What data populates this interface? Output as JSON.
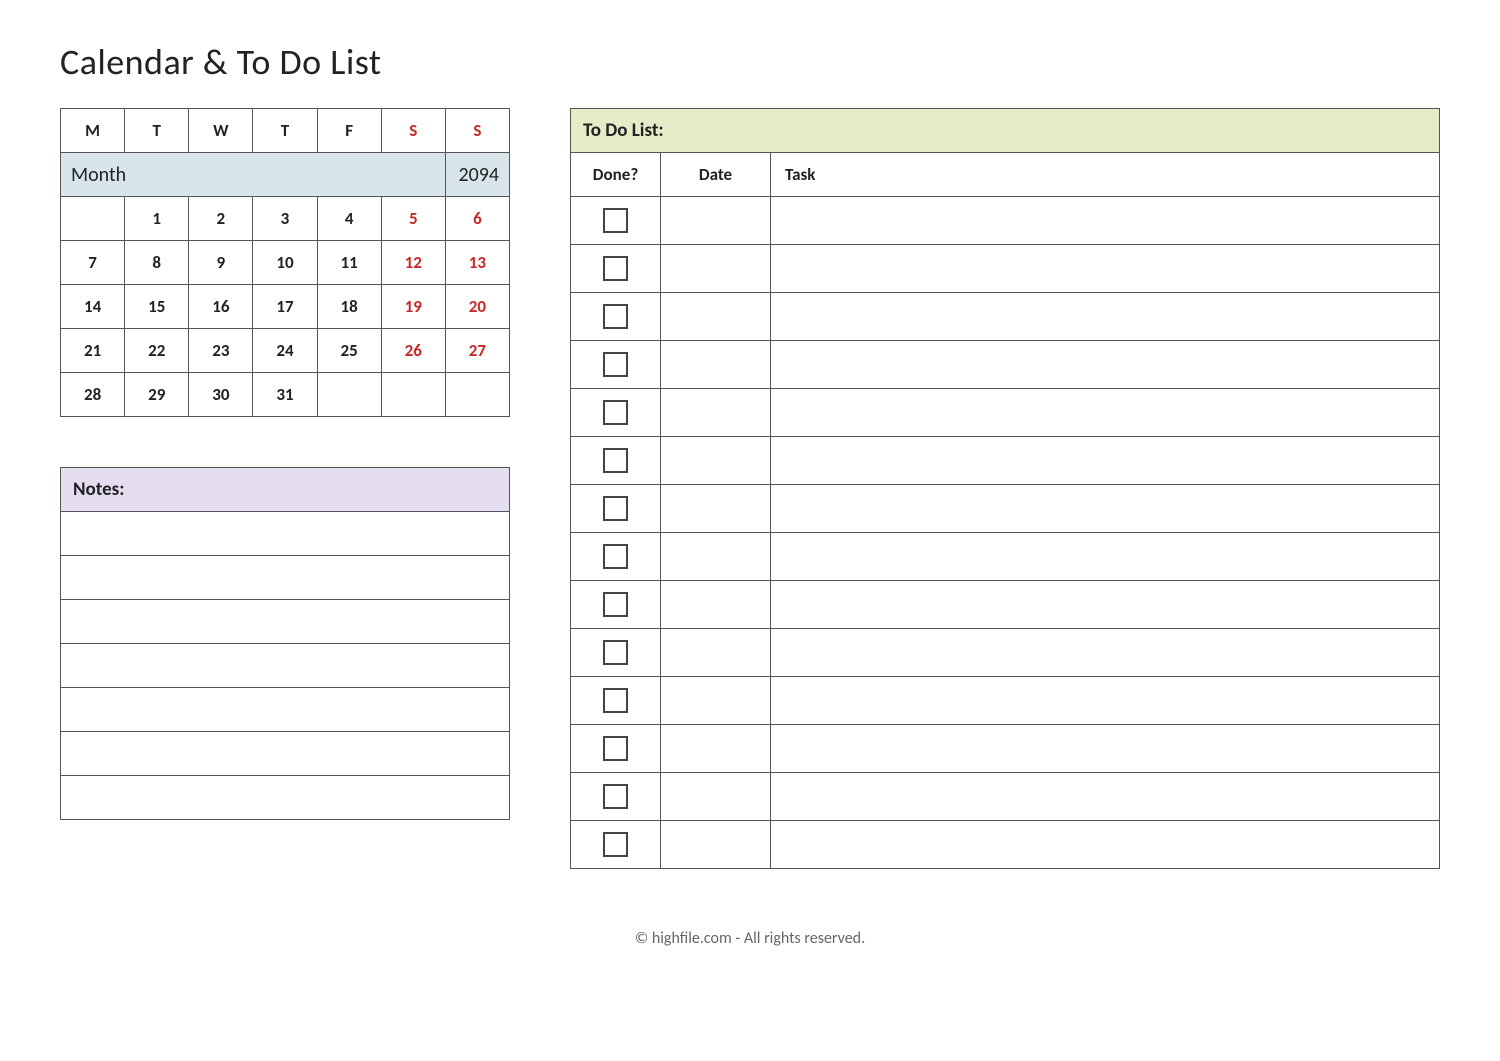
{
  "title": "Calendar & To Do List",
  "calendar": {
    "month_label": "Month",
    "year": "2094",
    "day_headers": [
      "M",
      "T",
      "W",
      "T",
      "F",
      "S",
      "S"
    ],
    "weeks": [
      [
        "",
        "1",
        "2",
        "3",
        "4",
        "5",
        "6"
      ],
      [
        "7",
        "8",
        "9",
        "10",
        "11",
        "12",
        "13"
      ],
      [
        "14",
        "15",
        "16",
        "17",
        "18",
        "19",
        "20"
      ],
      [
        "21",
        "22",
        "23",
        "24",
        "25",
        "26",
        "27"
      ],
      [
        "28",
        "29",
        "30",
        "31",
        "",
        "",
        ""
      ]
    ]
  },
  "notes": {
    "title": "Notes:",
    "rows": [
      "",
      "",
      "",
      "",
      "",
      "",
      ""
    ]
  },
  "todo": {
    "title": "To Do List:",
    "columns": {
      "done": "Done?",
      "date": "Date",
      "task": "Task"
    },
    "rows": [
      {
        "done": false,
        "date": "",
        "task": ""
      },
      {
        "done": false,
        "date": "",
        "task": ""
      },
      {
        "done": false,
        "date": "",
        "task": ""
      },
      {
        "done": false,
        "date": "",
        "task": ""
      },
      {
        "done": false,
        "date": "",
        "task": ""
      },
      {
        "done": false,
        "date": "",
        "task": ""
      },
      {
        "done": false,
        "date": "",
        "task": ""
      },
      {
        "done": false,
        "date": "",
        "task": ""
      },
      {
        "done": false,
        "date": "",
        "task": ""
      },
      {
        "done": false,
        "date": "",
        "task": ""
      },
      {
        "done": false,
        "date": "",
        "task": ""
      },
      {
        "done": false,
        "date": "",
        "task": ""
      },
      {
        "done": false,
        "date": "",
        "task": ""
      },
      {
        "done": false,
        "date": "",
        "task": ""
      }
    ]
  },
  "footer": "© highfile.com - All rights reserved."
}
